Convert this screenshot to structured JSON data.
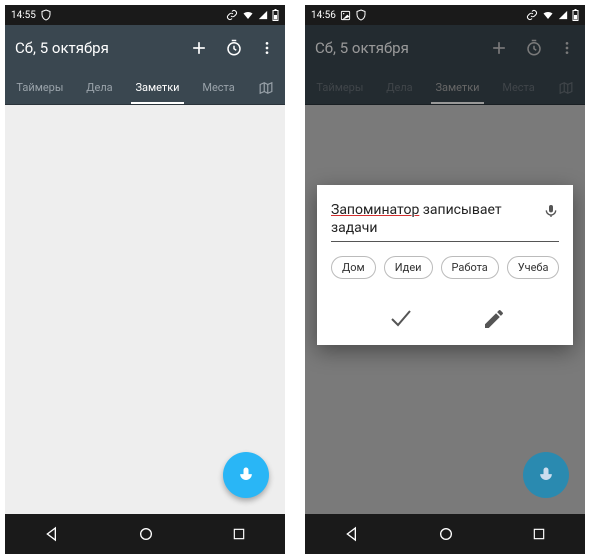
{
  "left": {
    "status_time": "14:55",
    "appbar_title": "Сб, 5 октября",
    "tabs": {
      "timers": "Таймеры",
      "todos": "Дела",
      "notes": "Заметки",
      "places": "Места"
    }
  },
  "right": {
    "status_time": "14:56",
    "appbar_title": "Сб, 5 октября",
    "tabs": {
      "timers": "Таймеры",
      "todos": "Дела",
      "notes": "Заметки",
      "places": "Места"
    },
    "modal": {
      "note_word1": "Запоминатор",
      "note_rest": " записывает задачи",
      "chips": {
        "home": "Дом",
        "ideas": "Идеи",
        "work": "Работа",
        "study": "Учеба"
      }
    }
  }
}
